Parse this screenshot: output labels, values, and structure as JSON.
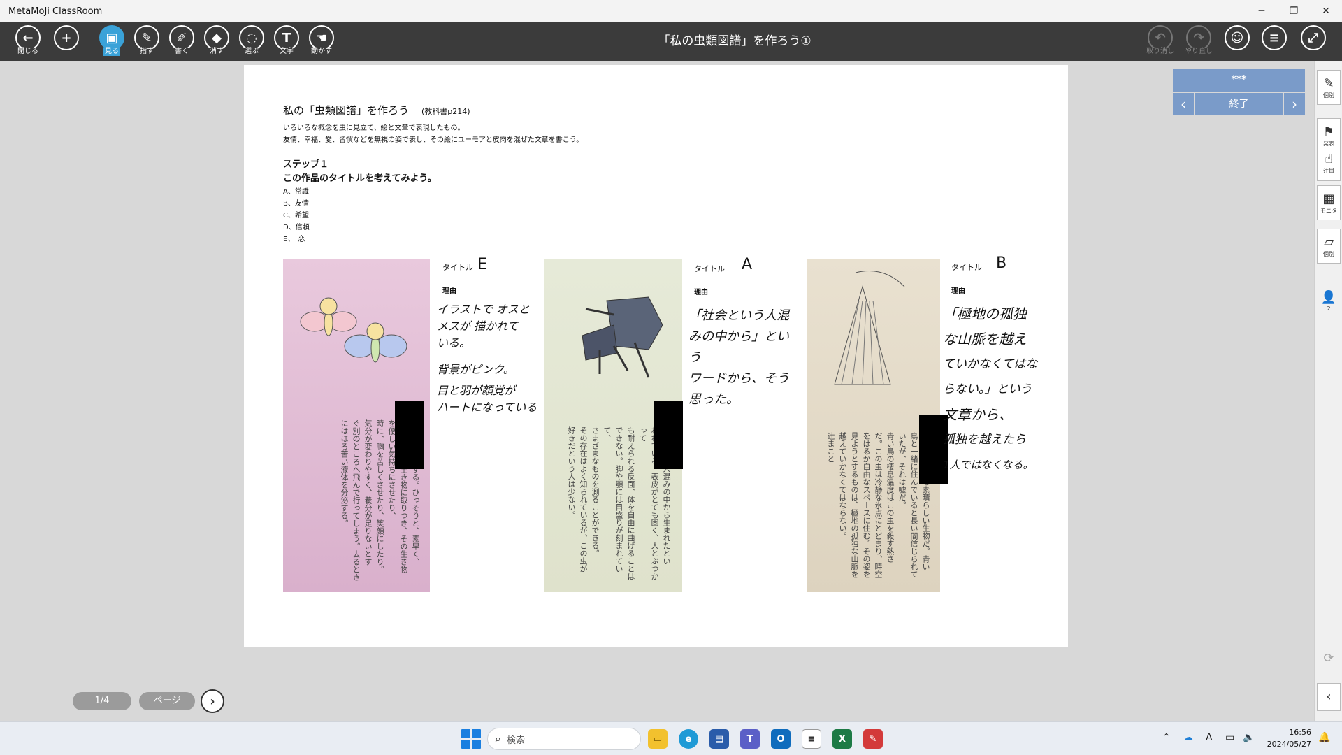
{
  "window": {
    "app_name": "MetaMoJi ClassRoom",
    "minimize": "─",
    "restore": "❐",
    "close": "✕"
  },
  "toolbar": {
    "title": "「私の虫類図譜」を作ろう①",
    "tools": [
      {
        "id": "close",
        "label": "閉じる",
        "glyph": "←"
      },
      {
        "id": "add",
        "label": "",
        "glyph": "+"
      },
      {
        "id": "view",
        "label": "見る",
        "glyph": "▣"
      },
      {
        "id": "point",
        "label": "指す",
        "glyph": "✎"
      },
      {
        "id": "write",
        "label": "書く",
        "glyph": "✐"
      },
      {
        "id": "erase",
        "label": "消す",
        "glyph": "◆"
      },
      {
        "id": "select",
        "label": "選ぶ",
        "glyph": "◌"
      },
      {
        "id": "text",
        "label": "文字",
        "glyph": "T"
      },
      {
        "id": "move",
        "label": "動かす",
        "glyph": "☚"
      }
    ],
    "undo_label": "取り消し",
    "redo_label": "やり直し"
  },
  "page": {
    "heading": "私の「虫類図譜」を作ろう",
    "heading_ref": "(教科書p214)",
    "desc1": "いろいろな概念を虫に見立て、絵と文章で表現したもの。",
    "desc2": "友情、幸福、愛、習慣などを無視の姿で表し、その絵にユーモアと皮肉を混ぜた文章を書こう。",
    "step_title": "ステップ１",
    "step_question": "この作品のタイトルを考えてみよう。",
    "options": [
      "A、常識",
      "B、友情",
      "C、希望",
      "D、信頼",
      "E、　恋"
    ],
    "cards": [
      {
        "title_label": "タイトル",
        "title_answer": "E",
        "reason_label": "理由",
        "handwriting": [
          "イラストで オスと",
          "メスが 描かれて",
          "いる。",
          "背景がピンク。",
          "目と羽が顔覚が",
          "ハートになっている"
        ],
        "book_text": [
          "主に春に繁殖する。ひっそりと、素早く、",
          "突然にほかの生き物に取りつき、その生き物",
          "を優しい気持ちにさせたり、",
          "時に、胸を苦しくさせたり、笑顔にしたり。",
          "気分が変わりやすく、養分が足りないとす",
          "ぐ別のところへ飛んで行ってしまう。去るとき",
          "にはほろ苦い液体を分泌する。"
        ]
      },
      {
        "title_label": "タイトル",
        "title_answer": "A",
        "reason_label": "理由",
        "handwriting": [
          "「社会という人混",
          "みの中から」という",
          "ワードから、そう",
          "思った。"
        ],
        "book_text": [
          "社会という人混みの中から生まれたとい",
          "われている。表皮がとても固く、人とぶつかって",
          "も耐えられる反面、体を自由に曲げることは",
          "できない。脚や顎には目盛りが刻まれていて、",
          "さまざまなものを測ることができる。",
          "その存在はよく知られているが、この虫が",
          "好きだという人は少ない。"
        ]
      },
      {
        "title_label": "タイトル",
        "title_answer": "B",
        "reason_label": "理由",
        "handwriting": [
          "「極地の孤独",
          "な山脈を越え",
          "ていかなくてはな",
          "らない。」という",
          "文章から、",
          "孤独を越えたら",
          "1人ではなくなる。"
        ],
        "book_text": [
          "これはきれいな素晴らしい生物だ。青い",
          "鳥と一緒に住んでいると長い間信じられて",
          "いたが、それは嘘だ。",
          "青い鳥の棲息温度はこの虫を殺す熱さ",
          "だ。この虫は冷静な氷点にとどまり、時空",
          "をはるか自由なスペースに住む。その姿を",
          "見ようとするものは、極地の孤独な山脈を",
          "越えていかなくてはならない。",
          "辻まこと"
        ]
      }
    ]
  },
  "panel": {
    "top_label": "***",
    "end_label": "終了",
    "prev": "‹",
    "next": "›"
  },
  "side": [
    {
      "id": "individual-1",
      "label": "個別",
      "glyph": "✎"
    },
    {
      "id": "present",
      "label": "発表",
      "glyph": "⚑"
    },
    {
      "id": "attention",
      "label": "注目",
      "glyph": "☝"
    },
    {
      "id": "monitor",
      "label": "モニタ",
      "glyph": "▦"
    },
    {
      "id": "individual-2",
      "label": "個別",
      "glyph": "▱"
    },
    {
      "id": "users",
      "label": "2",
      "glyph": "👤"
    }
  ],
  "pager": {
    "page_indicator": "1/4",
    "page_button": "ページ",
    "next": "›"
  },
  "taskbar": {
    "search_placeholder": "検索",
    "time": "16:56",
    "date": "2024/05/27",
    "ime": "A"
  }
}
